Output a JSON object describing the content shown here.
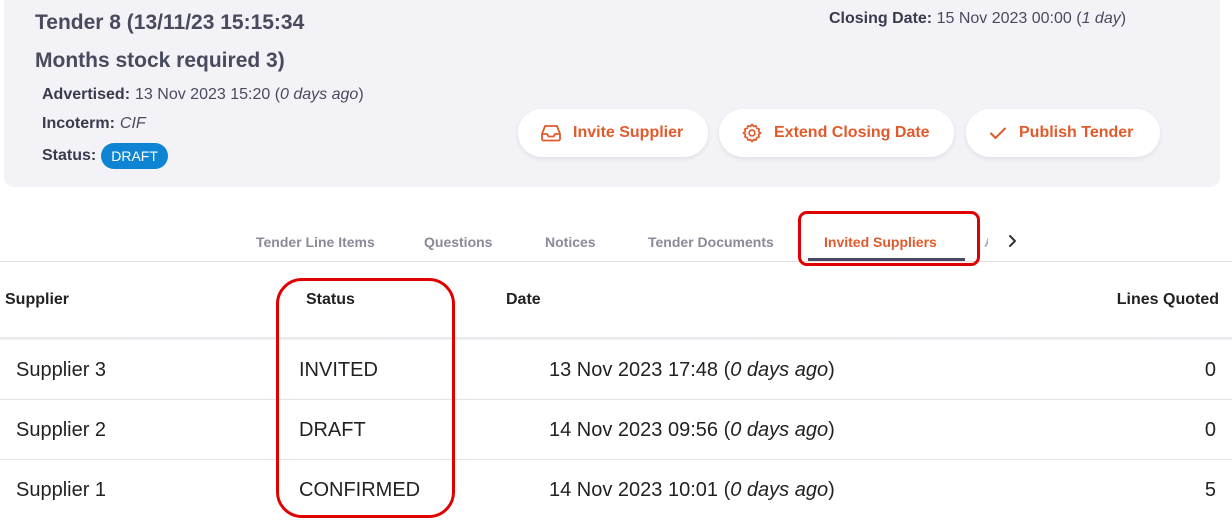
{
  "tender": {
    "title_line1": "Tender 8 (13/11/23 15:15:34",
    "title_line2": "Months stock required 3)",
    "advertised_label": "Advertised:",
    "advertised_value": "13 Nov 2023 15:20",
    "advertised_ago": "0 days ago",
    "incoterm_label": "Incoterm:",
    "incoterm_value": "CIF",
    "status_label": "Status:",
    "status_value": "DRAFT",
    "closing_label": "Closing Date:",
    "closing_value": "15 Nov 2023 00:00",
    "closing_remaining": "1 day"
  },
  "actions": {
    "invite_label": "Invite Supplier",
    "extend_label": "Extend Closing Date",
    "publish_label": "Publish Tender"
  },
  "tabs": [
    {
      "label": "Tender Line Items"
    },
    {
      "label": "Questions"
    },
    {
      "label": "Notices"
    },
    {
      "label": "Tender Documents"
    },
    {
      "label": "Invited Suppliers",
      "active": true
    }
  ],
  "table": {
    "headers": {
      "supplier": "Supplier",
      "status": "Status",
      "date": "Date",
      "lines_quoted": "Lines Quoted"
    },
    "rows": [
      {
        "supplier": "Supplier 3",
        "status": "INVITED",
        "date": "13 Nov 2023 17:48",
        "ago": "0 days ago",
        "lines_quoted": "0"
      },
      {
        "supplier": "Supplier 2",
        "status": "DRAFT",
        "date": "14 Nov 2023 09:56",
        "ago": "0 days ago",
        "lines_quoted": "0"
      },
      {
        "supplier": "Supplier 1",
        "status": "CONFIRMED",
        "date": "14 Nov 2023 10:01",
        "ago": "0 days ago",
        "lines_quoted": "5"
      }
    ]
  },
  "colors": {
    "accent": "#e05a2b",
    "badge": "#0e84d2",
    "highlight": "#e00000",
    "header_bg": "#f2f2f7"
  },
  "icons": {
    "invite": "inbox-icon",
    "extend": "gear-icon",
    "publish": "check-icon",
    "tabs_next": "chevron-right-icon"
  }
}
